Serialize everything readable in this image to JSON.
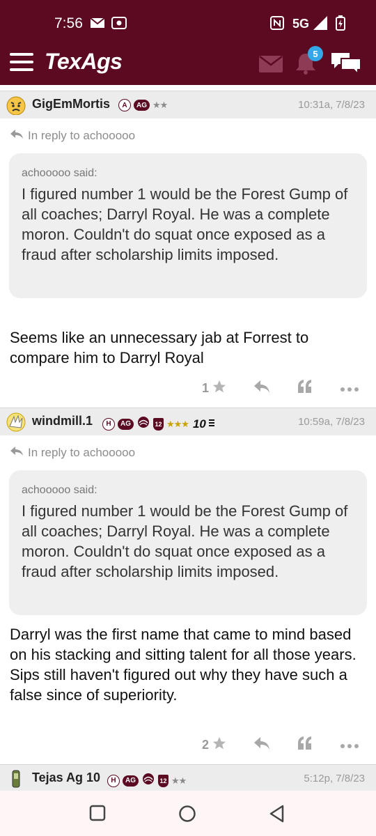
{
  "status_bar": {
    "time": "7:56",
    "network": "5G",
    "icons": [
      "mail-icon",
      "screen-record-icon",
      "nfc-icon",
      "signal-icon",
      "battery-charging-icon"
    ]
  },
  "app_bar": {
    "logo": "TexAgs",
    "notification_count": "5",
    "icons": [
      "menu-icon",
      "mail-icon",
      "bell-icon",
      "chat-icon"
    ],
    "background_color": "#5c0a22"
  },
  "posts": [
    {
      "username": "GigEmMortis",
      "badges": [
        "A",
        "AG"
      ],
      "stars": "★★",
      "timestamp": "10:31a, 7/8/23",
      "reply_to": "In reply to achooooo",
      "quote_author": "achooooo said:",
      "quote_text": "I figured number 1 would be the Forest Gump of all coaches; Darryl Royal. He was a complete moron. Couldn't do squat once exposed as a fraud after scholarship limits imposed.",
      "body": "Seems like an unnecessary jab at Forrest to compare him to Darryl Royal",
      "likes": "1"
    },
    {
      "username": "windmill.1",
      "badges": [
        "H",
        "AG",
        "12"
      ],
      "stars": "★★★",
      "extra": "10",
      "timestamp": "10:59a, 7/8/23",
      "reply_to": "In reply to achooooo",
      "quote_author": "achooooo said:",
      "quote_text": "I figured number 1 would be the Forest Gump of all coaches; Darryl Royal. He was a complete moron. Couldn't do squat once exposed as a fraud after scholarship limits imposed.",
      "body_line1": "Darryl was the first name that came to mind based on his stacking and sitting talent for all those years.",
      "body_line2": "Sips still haven't figured out why they have such a false since of superiority.",
      "likes": "2"
    },
    {
      "username": "Tejas Ag 10",
      "badges": [
        "H",
        "AG",
        "12"
      ],
      "stars": "★★",
      "timestamp": "5:12p, 7/8/23"
    }
  ],
  "nav_bar": {
    "icons": [
      "recent-apps-icon",
      "home-icon",
      "back-icon"
    ]
  }
}
